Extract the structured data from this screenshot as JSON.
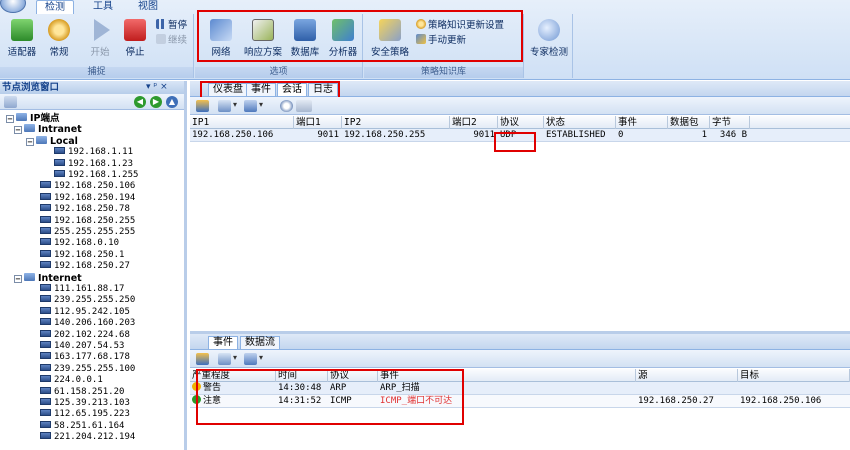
{
  "ribbon": {
    "tabs": [
      "检测",
      "工具",
      "视图"
    ],
    "active_tab": "检测",
    "groups": {
      "capture": {
        "label": "捕捉",
        "adapter": "适配器",
        "general": "常规",
        "start": "开始",
        "stop": "停止",
        "pause": "暂停",
        "resume": "继续"
      },
      "options": {
        "label": "选项",
        "network": "网络",
        "response": "响应方案",
        "database": "数据库",
        "analyzer": "分析器"
      },
      "policy": {
        "label": "策略知识库",
        "security": "安全策略",
        "update_settings": "策略知识更新设置",
        "manual_update": "手动更新"
      },
      "expert": {
        "label": "专家检测"
      }
    }
  },
  "left_pane": {
    "title": "节点浏览窗口",
    "pin": "▾ ᵖ ×",
    "tree": [
      {
        "label": "IP端点",
        "level": 0,
        "type": "root"
      },
      {
        "label": "Intranet",
        "level": 1,
        "type": "group"
      },
      {
        "label": "Local",
        "level": 2,
        "type": "group"
      },
      {
        "label": "192.168.1.11",
        "level": 3,
        "type": "host"
      },
      {
        "label": "192.168.1.23",
        "level": 3,
        "type": "host"
      },
      {
        "label": "192.168.1.255",
        "level": 3,
        "type": "host"
      },
      {
        "label": "192.168.250.106",
        "level": 2,
        "type": "host"
      },
      {
        "label": "192.168.250.194",
        "level": 2,
        "type": "host"
      },
      {
        "label": "192.168.250.78",
        "level": 2,
        "type": "host"
      },
      {
        "label": "192.168.250.255",
        "level": 2,
        "type": "host"
      },
      {
        "label": "255.255.255.255",
        "level": 2,
        "type": "host"
      },
      {
        "label": "192.168.0.10",
        "level": 2,
        "type": "host"
      },
      {
        "label": "192.168.250.1",
        "level": 2,
        "type": "host"
      },
      {
        "label": "192.168.250.27",
        "level": 2,
        "type": "host"
      },
      {
        "label": "Internet",
        "level": 1,
        "type": "group"
      },
      {
        "label": "111.161.88.17",
        "level": 2,
        "type": "host"
      },
      {
        "label": "239.255.255.250",
        "level": 2,
        "type": "host"
      },
      {
        "label": "112.95.242.105",
        "level": 2,
        "type": "host"
      },
      {
        "label": "140.206.160.203",
        "level": 2,
        "type": "host"
      },
      {
        "label": "202.102.224.68",
        "level": 2,
        "type": "host"
      },
      {
        "label": "140.207.54.53",
        "level": 2,
        "type": "host"
      },
      {
        "label": "163.177.68.178",
        "level": 2,
        "type": "host"
      },
      {
        "label": "239.255.255.100",
        "level": 2,
        "type": "host"
      },
      {
        "label": "224.0.0.1",
        "level": 2,
        "type": "host"
      },
      {
        "label": "61.158.251.20",
        "level": 2,
        "type": "host"
      },
      {
        "label": "125.39.213.103",
        "level": 2,
        "type": "host"
      },
      {
        "label": "112.65.195.223",
        "level": 2,
        "type": "host"
      },
      {
        "label": "58.251.61.164",
        "level": 2,
        "type": "host"
      },
      {
        "label": "221.204.212.194",
        "level": 2,
        "type": "host"
      }
    ]
  },
  "doc_tabs": [
    "仪表盘",
    "事件",
    "会话",
    "日志"
  ],
  "active_doc_tab": "会话",
  "session_table": {
    "columns": [
      "IP1",
      "端口1",
      "IP2",
      "端口2",
      "协议",
      "状态",
      "事件",
      "数据包",
      "字节"
    ],
    "rows": [
      [
        "192.168.250.106",
        "9011",
        "192.168.250.255",
        "9011",
        "UDP",
        "ESTABLISHED",
        "0",
        "1",
        "346 B"
      ]
    ]
  },
  "bottom_tabs": [
    "事件",
    "数据流"
  ],
  "active_bottom_tab": "事件",
  "event_table": {
    "columns": [
      "严重程度",
      "时间",
      "协议",
      "事件",
      "源",
      "目标"
    ],
    "rows": [
      {
        "severity": "警告",
        "time": "14:30:48",
        "protocol": "ARP",
        "event": "ARP_扫描",
        "source": "",
        "target": "",
        "color": "#f0b000"
      },
      {
        "severity": "注意",
        "time": "14:31:52",
        "protocol": "ICMP",
        "event": "ICMP_端口不可达",
        "source": "192.168.250.27",
        "target": "192.168.250.106",
        "color": "#2a9a2a"
      }
    ]
  },
  "colors": {
    "highlight_box": "#e00000",
    "ribbon_bg": "#cfe0f5",
    "row_selected": "#e6eefa"
  }
}
